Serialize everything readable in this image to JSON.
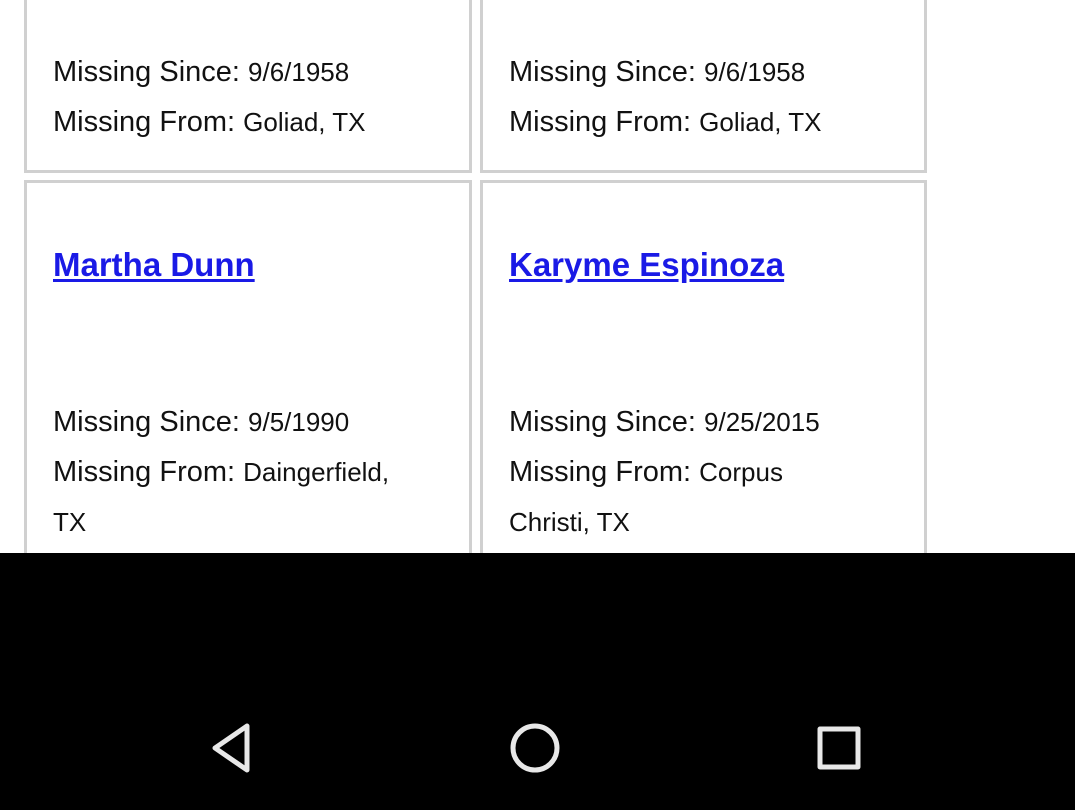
{
  "cards": [
    {
      "since_label": "Missing Since:",
      "since_value": "9/6/1958",
      "from_label": "Missing From:",
      "from_value": "Goliad, TX"
    },
    {
      "since_label": "Missing Since:",
      "since_value": "9/6/1958",
      "from_label": "Missing From:",
      "from_value": "Goliad, TX"
    },
    {
      "name": "Martha Dunn",
      "since_label": "Missing Since:",
      "since_value": "9/5/1990",
      "from_label": "Missing From:",
      "from_value_line1": "Daingerfield,",
      "from_value_line2": "TX"
    },
    {
      "name": "Karyme Espinoza",
      "since_label": "Missing Since:",
      "since_value": "9/25/2015",
      "from_label": "Missing From:",
      "from_value_line1": "Corpus",
      "from_value_line2": "Christi, TX"
    }
  ],
  "navbar": {
    "back_icon": "back-triangle-icon",
    "home_icon": "home-circle-icon",
    "recents_icon": "recents-square-icon",
    "background": "#000000",
    "icon_color": "#e8e8e8"
  },
  "link_color": "#1a1ae6"
}
